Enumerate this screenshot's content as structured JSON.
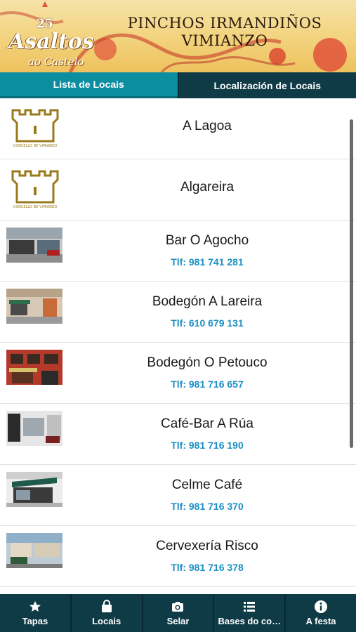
{
  "banner": {
    "logo_number": "25",
    "logo_main": "Asaltos",
    "logo_sub": "ao Castelo",
    "title_line1": "PINCHOS IRMANDIÑOS",
    "title_line2": "VIMIANZO"
  },
  "tabs": [
    {
      "label": "Lista de Locais",
      "active": true
    },
    {
      "label": "Localización de Locais",
      "active": false
    }
  ],
  "logo_caption": "CONCELLO DE VIMIANZO",
  "locales": [
    {
      "name": "A Lagoa",
      "phone": "",
      "image": "concello-logo"
    },
    {
      "name": "Algareira",
      "phone": "",
      "image": "concello-logo"
    },
    {
      "name": "Bar O Agocho",
      "phone": "Tlf: 981 741 281",
      "image": "storefront-photo"
    },
    {
      "name": "Bodegón A Lareira",
      "phone": "Tlf: 610 679 131",
      "image": "storefront-photo"
    },
    {
      "name": "Bodegón O Petouco",
      "phone": "Tlf: 981 716 657",
      "image": "storefront-photo"
    },
    {
      "name": "Café-Bar A Rúa",
      "phone": "Tlf: 981 716 190",
      "image": "storefront-photo"
    },
    {
      "name": "Celme Café",
      "phone": "Tlf: 981 716 370",
      "image": "storefront-photo"
    },
    {
      "name": "Cervexería Risco",
      "phone": "Tlf: 981 716 378",
      "image": "storefront-photo"
    }
  ],
  "bottom_nav": [
    {
      "label": "Tapas",
      "icon": "star-icon"
    },
    {
      "label": "Locais",
      "icon": "bag-icon"
    },
    {
      "label": "Selar",
      "icon": "camera-icon"
    },
    {
      "label": "Bases do co…",
      "icon": "list-icon"
    },
    {
      "label": "A festa",
      "icon": "info-icon"
    }
  ],
  "colors": {
    "tab_active": "#0d8ea0",
    "nav_background": "#0f3b47",
    "phone_text": "#1b8fc4",
    "logo_gold": "#9a7a1c"
  }
}
